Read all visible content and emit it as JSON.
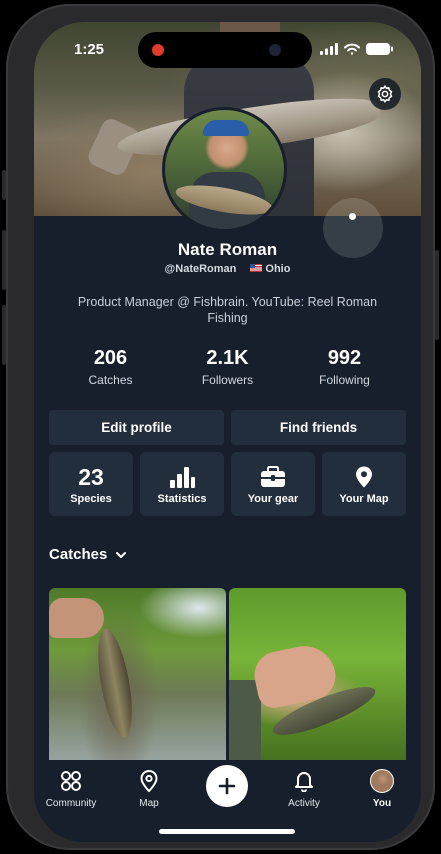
{
  "status_bar": {
    "time": "1:25"
  },
  "profile": {
    "name": "Nate Roman",
    "handle": "@NateRoman",
    "location": "Ohio",
    "bio": "Product Manager @ Fishbrain. YouTube: Reel Roman Fishing"
  },
  "stats": [
    {
      "value": "206",
      "label": "Catches"
    },
    {
      "value": "2.1K",
      "label": "Followers"
    },
    {
      "value": "992",
      "label": "Following"
    }
  ],
  "actions": {
    "edit_profile": "Edit profile",
    "find_friends": "Find friends"
  },
  "tiles": {
    "species": {
      "value": "23",
      "label": "Species"
    },
    "statistics": {
      "label": "Statistics",
      "icon": "bar-chart-icon"
    },
    "gear": {
      "label": "Your gear",
      "icon": "tackle-box-icon"
    },
    "map": {
      "label": "Your Map",
      "icon": "map-pin-icon"
    }
  },
  "catches": {
    "title": "Catches"
  },
  "tabbar": {
    "community": "Community",
    "map": "Map",
    "activity": "Activity",
    "you": "You"
  },
  "colors": {
    "background": "#161f2b",
    "card": "#232e3d",
    "text": "#ffffff"
  }
}
